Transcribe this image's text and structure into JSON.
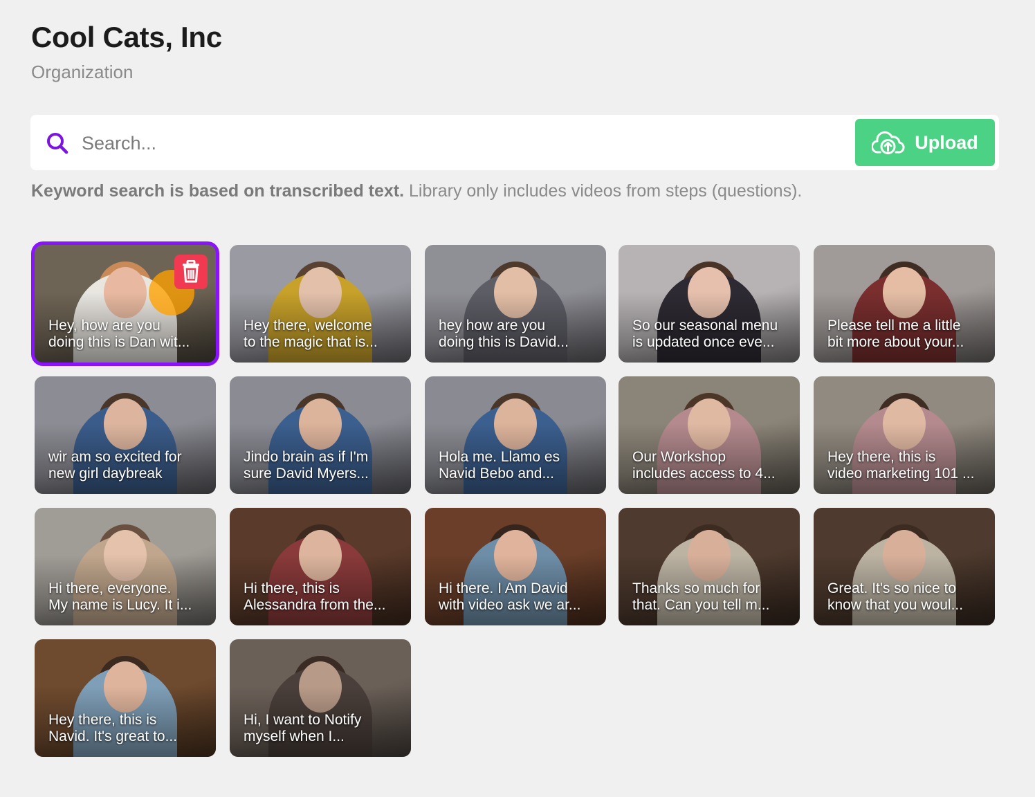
{
  "header": {
    "title": "Cool Cats, Inc",
    "subtitle": "Organization"
  },
  "search": {
    "placeholder": "Search...",
    "value": "",
    "upload_label": "Upload"
  },
  "hint": {
    "bold": "Keyword search is based on transcribed text.",
    "rest": " Library only includes videos from steps (questions)."
  },
  "videos": [
    {
      "line1": "Hey, how are you",
      "line2": "doing this is Dan wit...",
      "selected": true,
      "bg": "#6e6455",
      "shirt": "#e9e6e0",
      "skin": "#e8b9a0",
      "hair": "#c98a57"
    },
    {
      "line1": "Hey there, welcome",
      "line2": "to the magic that is...",
      "bg": "#9a9aa2",
      "shirt": "#c7a12a",
      "skin": "#e3c0aa",
      "hair": "#5a4232"
    },
    {
      "line1": "hey how are you",
      "line2": "doing this is David...",
      "bg": "#8f8f96",
      "shirt": "#5d5d66",
      "skin": "#e2bea6",
      "hair": "#4e3a2c"
    },
    {
      "line1": "So our seasonal menu",
      "line2": "is updated once eve...",
      "bg": "#b7b3b4",
      "shirt": "#2e2a33",
      "skin": "#e6c0ad",
      "hair": "#4a3427"
    },
    {
      "line1": "Please tell me a little",
      "line2": "bit more about your...",
      "bg": "#a09a98",
      "shirt": "#7a2e2e",
      "skin": "#e5bda5",
      "hair": "#3f2d24"
    },
    {
      "line1": "wir am so excited for",
      "line2": "new girl daybreak",
      "bg": "#8c8c94",
      "shirt": "#3a5c8a",
      "skin": "#ddb59e",
      "hair": "#4a3629"
    },
    {
      "line1": "Jindo brain as if I'm",
      "line2": "sure David Myers...",
      "bg": "#8a8b93",
      "shirt": "#3b5f8f",
      "skin": "#dcb39b",
      "hair": "#4a3629"
    },
    {
      "line1": "Hola me. Llamo es",
      "line2": "Navid Bebo and...",
      "bg": "#8a8b92",
      "shirt": "#3b5f8f",
      "skin": "#dcb39b",
      "hair": "#4a3629"
    },
    {
      "line1": "Our Workshop",
      "line2": "includes access to 4...",
      "bg": "#8b8478",
      "shirt": "#b48a8e",
      "skin": "#e0b9a2",
      "hair": "#4b3628"
    },
    {
      "line1": "Hey there, this is",
      "line2": "video marketing 101 ...",
      "bg": "#918a80",
      "shirt": "#b48a8e",
      "skin": "#e0b9a2",
      "hair": "#3f2c22"
    },
    {
      "line1": "Hi there, everyone.",
      "line2": "My name is Lucy. It i...",
      "bg": "#a09c96",
      "shirt": "#c0a68c",
      "skin": "#e4c2ab",
      "hair": "#6a5040"
    },
    {
      "line1": "Hi there, this is",
      "line2": "Alessandra from the...",
      "bg": "#5a3a2a",
      "shirt": "#8a3a3a",
      "skin": "#ddb59e",
      "hair": "#3c2a20"
    },
    {
      "line1": "Hi there. I Am David",
      "line2": "with video ask we ar...",
      "bg": "#6a3e28",
      "shirt": "#6e8ea8",
      "skin": "#e0b49c",
      "hair": "#35251c"
    },
    {
      "line1": "Thanks so much for",
      "line2": "that. Can you tell m...",
      "bg": "#4e3a2e",
      "shirt": "#bcb3a3",
      "skin": "#d8b09a",
      "hair": "#3c2b21"
    },
    {
      "line1": "Great. It's so nice to",
      "line2": "know that you woul...",
      "bg": "#4e3a2e",
      "shirt": "#bcb3a3",
      "skin": "#d8b09a",
      "hair": "#3c2b21"
    },
    {
      "line1": "Hey there, this is",
      "line2": "Navid. It's great to...",
      "bg": "#6e4a2e",
      "shirt": "#7f9fb8",
      "skin": "#dfb49c",
      "hair": "#3a2a20"
    },
    {
      "line1": "Hi, I want to Notify",
      "line2": "myself when I...",
      "bg": "#6b6058",
      "shirt": "#4a3f3a",
      "skin": "#b89a88",
      "hair": "#3a2c25"
    }
  ]
}
